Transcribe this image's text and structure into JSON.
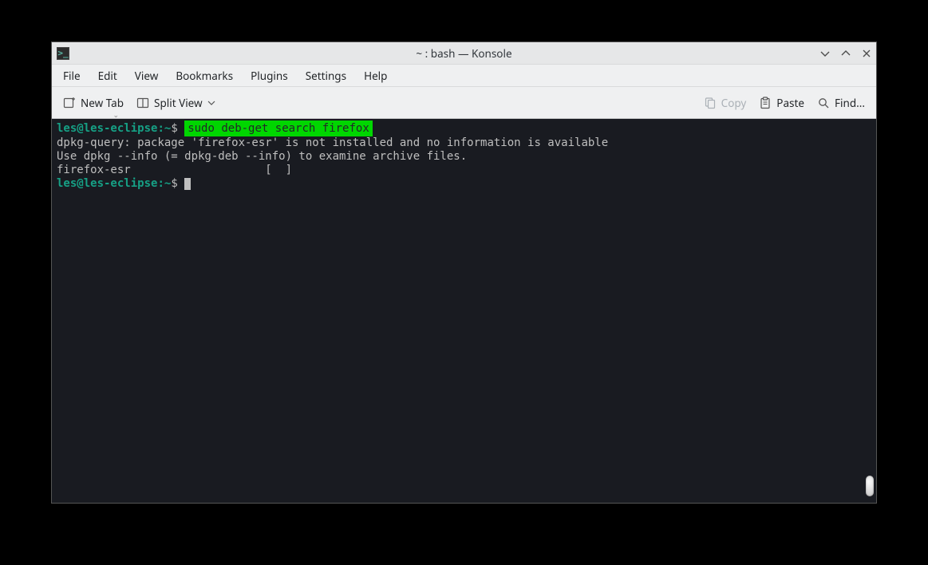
{
  "window": {
    "title": "~ : bash — Konsole"
  },
  "menubar": {
    "file": "File",
    "edit": "Edit",
    "view": "View",
    "bookmarks": "Bookmarks",
    "plugins": "Plugins",
    "settings": "Settings",
    "help": "Help"
  },
  "toolbar": {
    "new_tab": "New Tab",
    "split_view": "Split View",
    "copy": "Copy",
    "paste": "Paste",
    "find": "Find..."
  },
  "terminal": {
    "prompt_user": "les@les-eclipse",
    "prompt_sep": ":",
    "prompt_path": "~",
    "prompt_end": "$",
    "cmd1": "sudo deb-get search firefox",
    "out1": "dpkg-query: package 'firefox-esr' is not installed and no information is available",
    "out2": "Use dpkg --info (= dpkg-deb --info) to examine archive files.",
    "out3": "firefox-esr                    [  ]"
  }
}
